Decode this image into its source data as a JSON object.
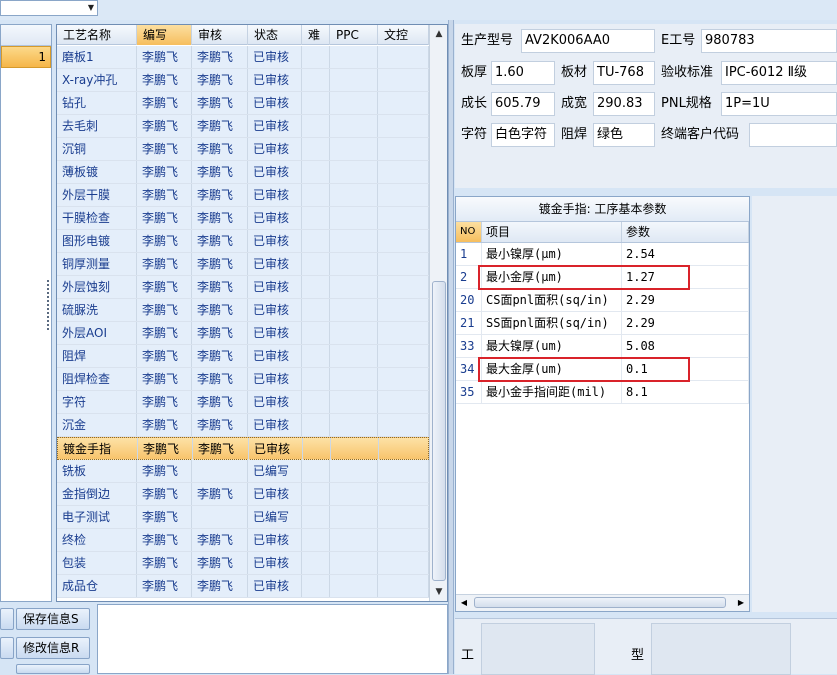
{
  "process_grid": {
    "columns": [
      "工艺名称",
      "编写",
      "审核",
      "状态",
      "难",
      "PPC",
      "文控"
    ],
    "rows": [
      [
        "磨板1",
        "李鹏飞",
        "李鹏飞",
        "已审核"
      ],
      [
        "X-ray冲孔",
        "李鹏飞",
        "李鹏飞",
        "已审核"
      ],
      [
        "钻孔",
        "李鹏飞",
        "李鹏飞",
        "已审核"
      ],
      [
        "去毛刺",
        "李鹏飞",
        "李鹏飞",
        "已审核"
      ],
      [
        "沉铜",
        "李鹏飞",
        "李鹏飞",
        "已审核"
      ],
      [
        "薄板镀",
        "李鹏飞",
        "李鹏飞",
        "已审核"
      ],
      [
        "外层干膜",
        "李鹏飞",
        "李鹏飞",
        "已审核"
      ],
      [
        "干膜检查",
        "李鹏飞",
        "李鹏飞",
        "已审核"
      ],
      [
        "图形电镀",
        "李鹏飞",
        "李鹏飞",
        "已审核"
      ],
      [
        "铜厚测量",
        "李鹏飞",
        "李鹏飞",
        "已审核"
      ],
      [
        "外层蚀刻",
        "李鹏飞",
        "李鹏飞",
        "已审核"
      ],
      [
        "硫脲洗",
        "李鹏飞",
        "李鹏飞",
        "已审核"
      ],
      [
        "外层AOI",
        "李鹏飞",
        "李鹏飞",
        "已审核"
      ],
      [
        "阻焊",
        "李鹏飞",
        "李鹏飞",
        "已审核"
      ],
      [
        "阻焊检查",
        "李鹏飞",
        "李鹏飞",
        "已审核"
      ],
      [
        "字符",
        "李鹏飞",
        "李鹏飞",
        "已审核"
      ],
      [
        "沉金",
        "李鹏飞",
        "李鹏飞",
        "已审核"
      ],
      [
        "镀金手指",
        "李鹏飞",
        "李鹏飞",
        "已审核"
      ],
      [
        "铣板",
        "李鹏飞",
        "",
        "已编写"
      ],
      [
        "金指倒边",
        "李鹏飞",
        "李鹏飞",
        "已审核"
      ],
      [
        "电子测试",
        "李鹏飞",
        "",
        "已编写"
      ],
      [
        "终检",
        "李鹏飞",
        "李鹏飞",
        "已审核"
      ],
      [
        "包装",
        "李鹏飞",
        "李鹏飞",
        "已审核"
      ],
      [
        "成品仓",
        "李鹏飞",
        "李鹏飞",
        "已审核"
      ]
    ],
    "selected_row": 17
  },
  "left_panel": {
    "selected_value": "1"
  },
  "buttons": {
    "save": "保存信息S",
    "edit": "修改信息R"
  },
  "info": {
    "model_label": "生产型号",
    "model_value": "AV2K006AA0",
    "eno_label": "E工号",
    "eno_value": "980783",
    "thickness_label": "板厚",
    "thickness_value": "1.60",
    "material_label": "板材",
    "material_value": "TU-768",
    "standard_label": "验收标准",
    "standard_value": "IPC-6012 Ⅱ级",
    "length_label": "成长",
    "length_value": "605.79",
    "width_label": "成宽",
    "width_value": "290.83",
    "pnl_label": "PNL规格",
    "pnl_value": "1P=1U",
    "char_label": "字符",
    "char_value": "白色字符",
    "solder_label": "阻焊",
    "solder_value": "绿色",
    "customer_label": "终端客户代码",
    "customer_value": ""
  },
  "params": {
    "title": "镀金手指: 工序基本参数",
    "columns": [
      "NO",
      "项目",
      "参数"
    ],
    "rows": [
      [
        "1",
        "最小镍厚(μm)",
        "2.54"
      ],
      [
        "2",
        "最小金厚(μm)",
        "1.27"
      ],
      [
        "20",
        "CS面pnl面积(sq/in)",
        "2.29"
      ],
      [
        "21",
        "SS面pnl面积(sq/in)",
        "2.29"
      ],
      [
        "33",
        "最大镍厚(um)",
        "5.08"
      ],
      [
        "34",
        "最大金厚(um)",
        "0.1"
      ],
      [
        "35",
        "最小金手指间距(mil)",
        "8.1"
      ]
    ]
  },
  "bottom_right": {
    "label1": "工",
    "label2": "型"
  },
  "colors": {
    "highlight": "#d9232a",
    "selected_row": "#f8c46c",
    "panel": "#d6e5f5"
  }
}
